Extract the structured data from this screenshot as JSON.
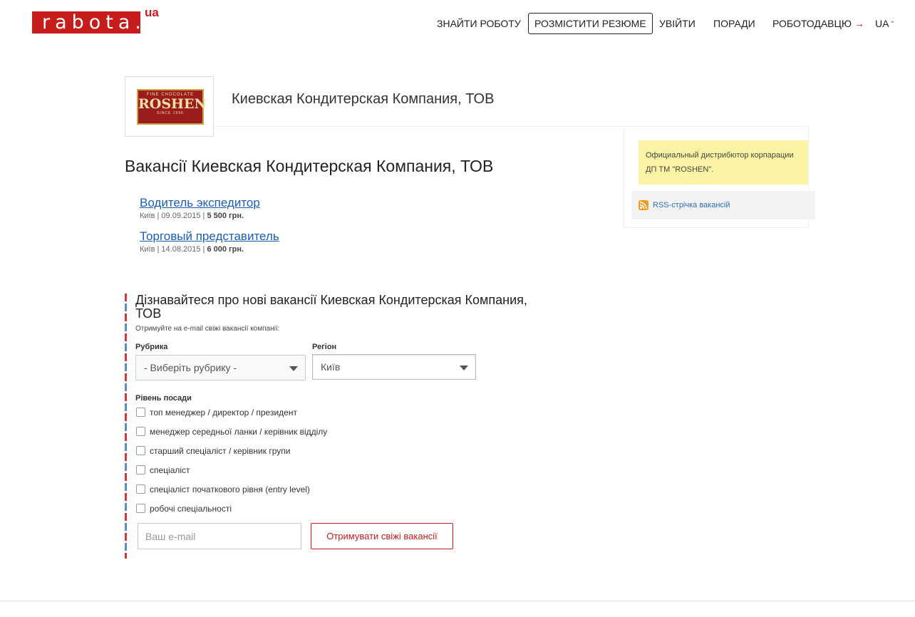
{
  "header": {
    "logo_text": "rabota.",
    "logo_suffix": "ua",
    "nav": {
      "find_job": "ЗНАЙТИ РОБОТУ",
      "post_resume": "РОЗМІСТИТИ РЕЗЮМЕ",
      "login": "УВІЙТИ",
      "tips": "ПОРАДИ",
      "employer": "РОБОТОДАВЦЮ",
      "employer_arrow": "→",
      "lang": "UA",
      "lang_caret": "ˇ"
    }
  },
  "company": {
    "logo": {
      "fine": "FINE CHOCOLATE",
      "name": "ROSHEN",
      "since": "SINCE 1996"
    },
    "name": "Киевская Кондитерская Компания, ТОВ"
  },
  "sidebar": {
    "promo_line1": "Официальный дистрибютор корпарации",
    "promo_line2": "ДП ТМ \"ROSHEN\".",
    "rss_label": "RSS-стрічка вакансій"
  },
  "vacancies": {
    "title": "Вакансії Киевская Кондитерская Компания, ТОВ",
    "items": [
      {
        "title": "Водитель экспедитор",
        "meta": "Київ | 09.09.2015  | ",
        "salary": "5 500 грн."
      },
      {
        "title": "Торговый представитель",
        "meta": "Київ | 14.08.2015  | ",
        "salary": "6 000 грн."
      }
    ]
  },
  "subscribe": {
    "title": "Дізнавайтеся про нові вакансії Киевская Кондитерская Компания, ТОВ",
    "hint": "Отримуйте на e-mail свіжі вакансії компанії:",
    "rubric_label": "Рубрика",
    "rubric_value": "- Виберіть рубрику -",
    "region_label": "Регіон",
    "region_value": "Київ",
    "level_label": "Рівень посади",
    "levels": [
      "топ менеджер / директор / президент",
      "менеджер середньої ланки / керівник відділу",
      "старший спеціаліст / керівник групи",
      "спеціаліст",
      "спеціаліст початкового рівня (entry level)",
      "робочі спеціальності"
    ],
    "email_placeholder": "Ваш e-mail",
    "button": "Отримувати свіжі вакансії"
  },
  "colors": {
    "brand": "#c71c1c",
    "link": "#1a5fb4",
    "promo_bg": "#fbf4a5"
  }
}
